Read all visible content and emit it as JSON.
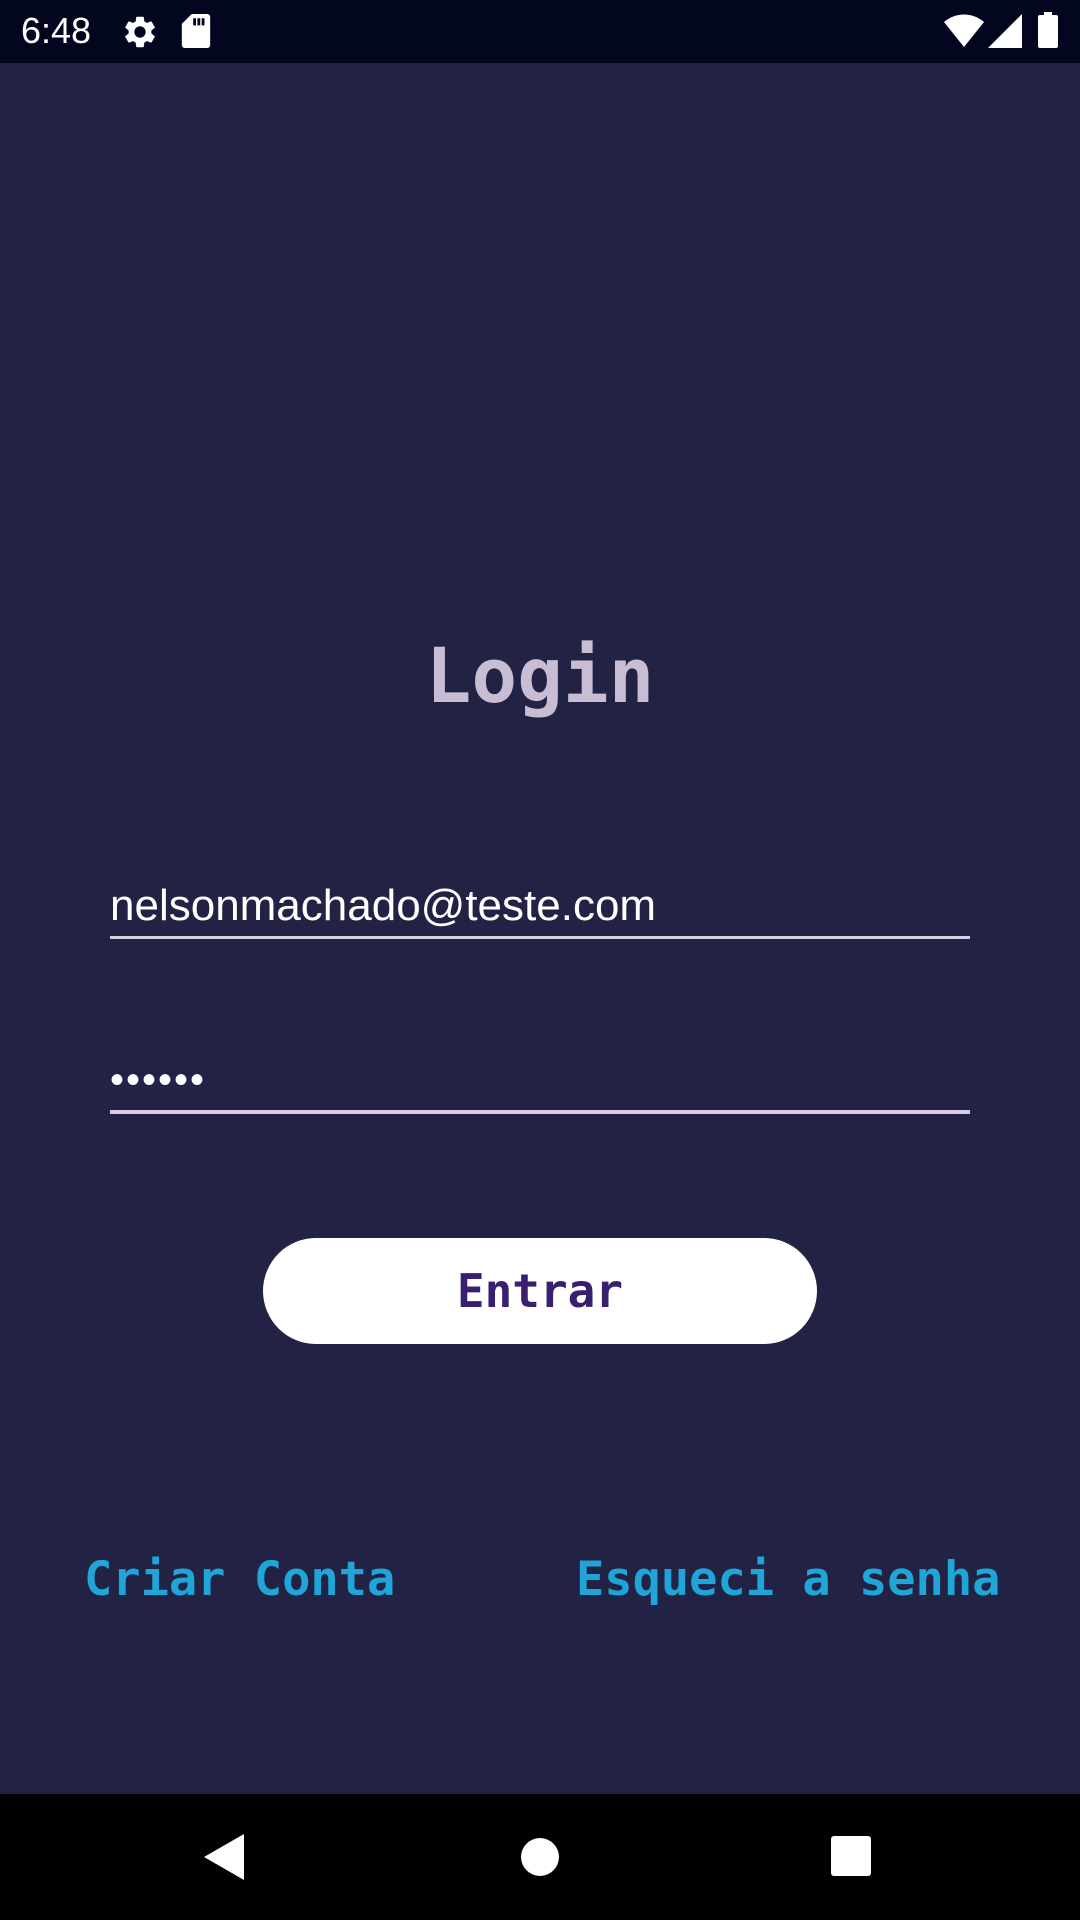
{
  "status_bar": {
    "time": "6:48",
    "icons": [
      "gear-icon",
      "sd-card-icon",
      "wifi-icon",
      "cellular-signal-icon",
      "battery-icon"
    ]
  },
  "login": {
    "title": "Login",
    "email_value": "nelsonmachado@teste.com",
    "password_mask": "••••••",
    "submit_label": "Entrar",
    "create_account_label": "Criar Conta",
    "forgot_password_label": "Esqueci a senha"
  },
  "nav_bar": {
    "icons": [
      "back-icon",
      "home-icon",
      "recents-icon"
    ]
  },
  "colors": {
    "background": "#222244",
    "status_bar": "#03061f",
    "title": "#c8bdd3",
    "link": "#1fa5d8",
    "button_bg": "#ffffff",
    "button_text": "#3a1f6e"
  }
}
